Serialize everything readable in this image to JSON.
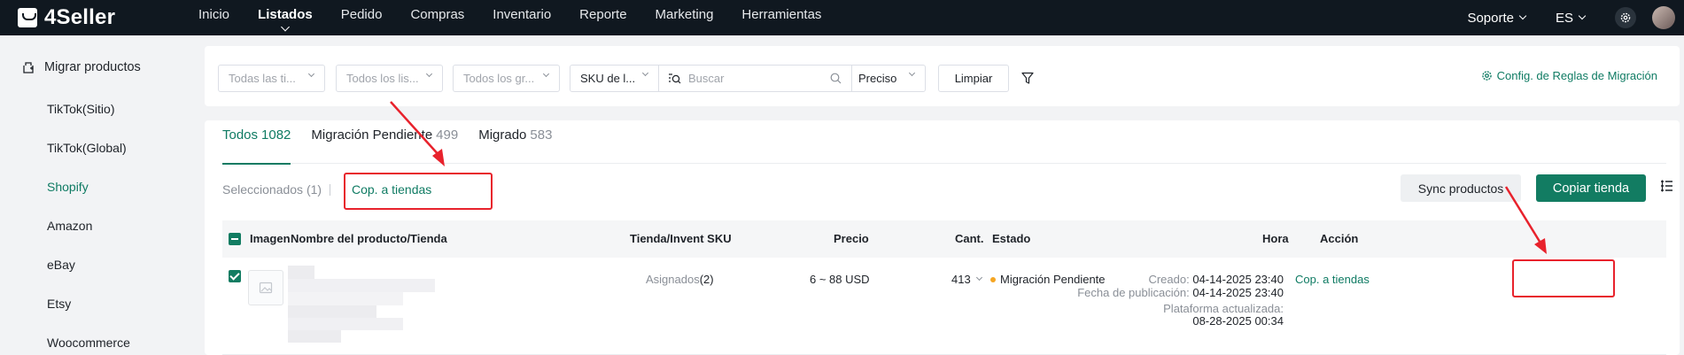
{
  "topbar": {
    "brand": "4Seller",
    "nav": [
      "Inicio",
      "Listados",
      "Pedido",
      "Compras",
      "Inventario",
      "Reporte",
      "Marketing",
      "Herramientas"
    ],
    "active_nav": "Listados",
    "support": "Soporte",
    "language": "ES"
  },
  "sidebar": {
    "header": "Migrar productos",
    "items": [
      "TikTok(Sitio)",
      "TikTok(Global)",
      "Shopify",
      "Amazon",
      "eBay",
      "Etsy",
      "Woocommerce"
    ],
    "active_item": "Shopify"
  },
  "filters": {
    "all_stores": "Todas las ti...",
    "all_listings": "Todos los lis...",
    "all_groups": "Todos los gr...",
    "sku_type": "SKU de l...",
    "search_placeholder": "Buscar",
    "price_type": "Preciso",
    "clear": "Limpiar",
    "rules_link": "Config. de Reglas de Migración"
  },
  "tabs": [
    {
      "label": "Todos",
      "count": "1082"
    },
    {
      "label": "Migración Pendiente",
      "count": "499"
    },
    {
      "label": "Migrado",
      "count": "583"
    }
  ],
  "bulk": {
    "selected": "Seleccionados (1)",
    "copy_to_stores": "Cop. a tiendas",
    "sync_products": "Sync productos",
    "copy_store": "Copiar tienda"
  },
  "table": {
    "headers": {
      "image": "Imagen",
      "name": "Nombre del producto/Tienda",
      "store_sku": "Tienda/Invent SKU",
      "price": "Precio",
      "qty": "Cant.",
      "status": "Estado",
      "time": "Hora",
      "action": "Acción"
    },
    "rows": [
      {
        "assigned_label": "Asignados",
        "assigned_count": "(2)",
        "price": "6 ~ 88 USD",
        "qty": "413",
        "status": "Migración Pendiente",
        "created_label": "Creado:",
        "created": "04-14-2025 23:40",
        "published_label": "Fecha de publicación:",
        "published": "04-14-2025 23:40",
        "updated_label": "Plataforma actualizada:",
        "updated": "08-28-2025 00:34",
        "action": "Cop. a tiendas"
      }
    ]
  },
  "colors": {
    "brand_green": "#127c62",
    "annotation_red": "#e8222c",
    "status_pending": "#f5a623"
  }
}
